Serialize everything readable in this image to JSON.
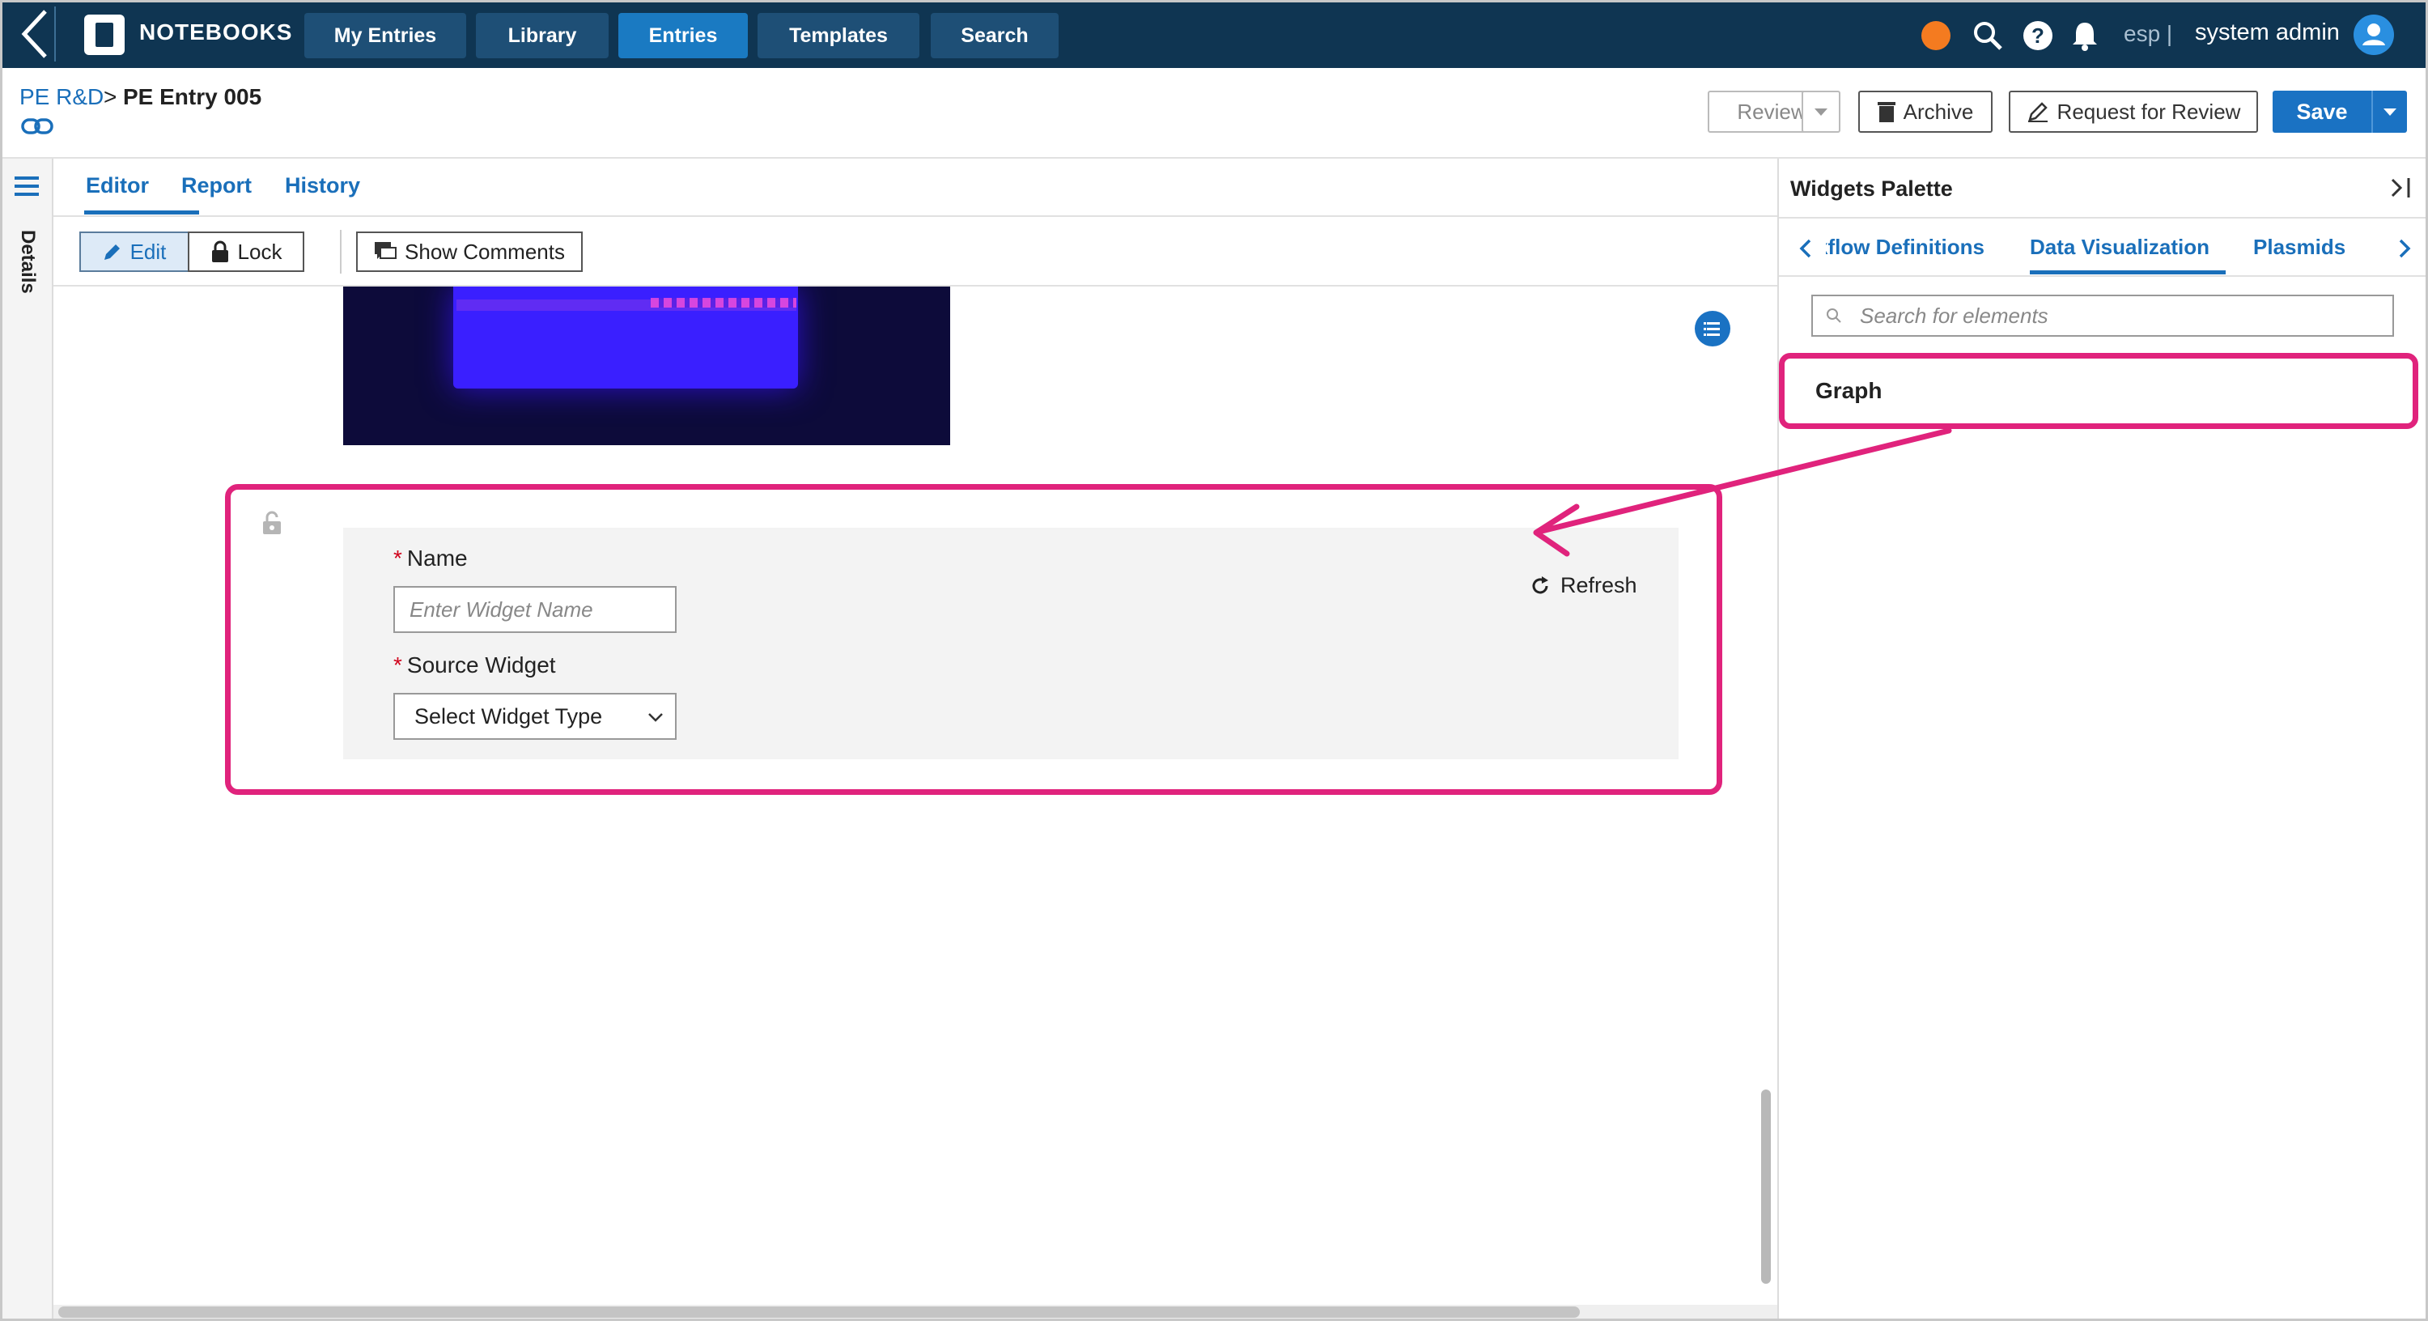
{
  "topnav": {
    "brand": "NOTEBOOKS",
    "items": [
      {
        "label": "My Entries",
        "active": false
      },
      {
        "label": "Library",
        "active": false
      },
      {
        "label": "Entries",
        "active": true
      },
      {
        "label": "Templates",
        "active": false
      },
      {
        "label": "Search",
        "active": false
      }
    ],
    "language": "esp |",
    "user": "system admin"
  },
  "breadcrumb": {
    "parent": "PE R&D",
    "separator": ">",
    "current": "PE Entry 005"
  },
  "header_actions": {
    "review": "Review",
    "archive": "Archive",
    "request_review": "Request for Review",
    "save": "Save"
  },
  "details_rail": {
    "label": "Details"
  },
  "editor": {
    "tabs": [
      "Editor",
      "Report",
      "History"
    ],
    "active_tab": "Editor",
    "toolbar": {
      "edit": "Edit",
      "lock": "Lock",
      "show_comments": "Show Comments"
    },
    "widget": {
      "name_label": "Name",
      "name_placeholder": "Enter Widget Name",
      "source_label": "Source Widget",
      "source_value": "Select Widget Type",
      "refresh": "Refresh"
    }
  },
  "palette": {
    "title": "Widgets Palette",
    "tabs": [
      "kflow Definitions",
      "Data Visualization",
      "Plasmids"
    ],
    "active_tab": "Data Visualization",
    "search_placeholder": "Search for elements",
    "items": [
      "Graph"
    ]
  },
  "colors": {
    "nav_bg": "#0f3552",
    "accent": "#1a72c3",
    "highlight": "#e0237c",
    "status_dot": "#f47b20"
  }
}
